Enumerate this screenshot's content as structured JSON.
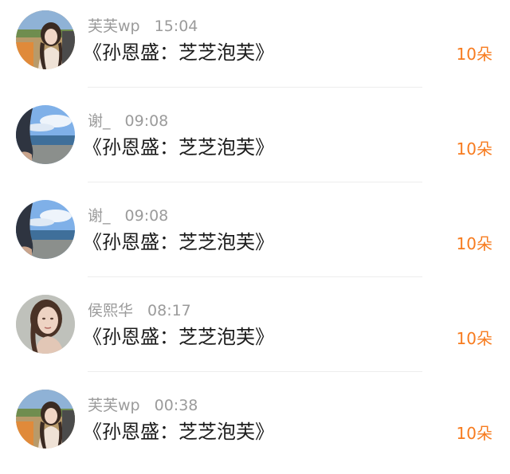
{
  "colors": {
    "username": "#9b9b9b",
    "title": "#1c1c1c",
    "gift": "#f77b1e",
    "divider": "#ededed"
  },
  "records": [
    {
      "avatar": "avatar-girl-car",
      "username": "芙芙wp",
      "time": "15:04",
      "title": "《孙恩盛：芝芝泡芙》",
      "gift": "10朵"
    },
    {
      "avatar": "avatar-seaside",
      "username": "谢_",
      "time": "09:08",
      "title": "《孙恩盛：芝芝泡芙》",
      "gift": "10朵"
    },
    {
      "avatar": "avatar-seaside",
      "username": "谢_",
      "time": "09:08",
      "title": "《孙恩盛：芝芝泡芙》",
      "gift": "10朵"
    },
    {
      "avatar": "avatar-portrait",
      "username": "侯熙华",
      "time": "08:17",
      "title": "《孙恩盛：芝芝泡芙》",
      "gift": "10朵"
    },
    {
      "avatar": "avatar-girl-car",
      "username": "芙芙wp",
      "time": "00:38",
      "title": "《孙恩盛：芝芝泡芙》",
      "gift": "10朵"
    }
  ]
}
